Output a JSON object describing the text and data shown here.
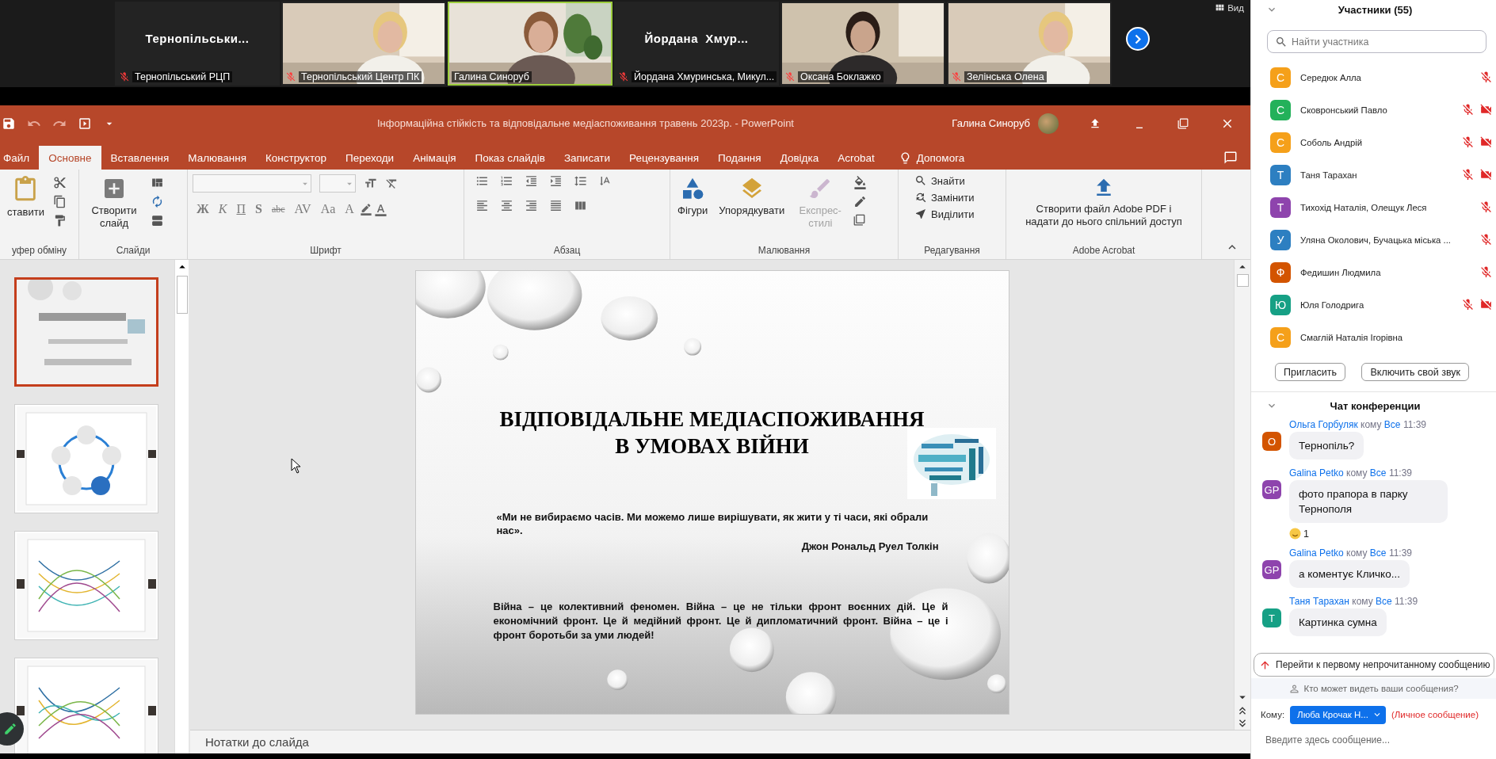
{
  "meeting_strip": {
    "tiles": [
      {
        "kind": "name",
        "display_name": "Тернопільськи...",
        "label": "Тернопільський РЦП",
        "muted": true,
        "speaking": false
      },
      {
        "kind": "video",
        "label": "Тернопільський Центр ПК",
        "muted": true,
        "speaking": false
      },
      {
        "kind": "video",
        "label": "Галина Синоруб",
        "muted": false,
        "speaking": true
      },
      {
        "kind": "name",
        "display_name": "Йордана  Хмур...",
        "label": "Йордана Хмуринська, Микул...",
        "muted": true,
        "speaking": false
      },
      {
        "kind": "video",
        "label": "Оксана Боклажко",
        "muted": true,
        "speaking": false
      },
      {
        "kind": "video",
        "label": "Зелінська Олена",
        "muted": true,
        "speaking": false
      }
    ],
    "view_button": "Вид"
  },
  "powerpoint": {
    "title": "Інформаційна стійкість та відповідальне медіаспоживання травень 2023р.  -  PowerPoint",
    "user": "Галина Синоруб",
    "tabs": [
      {
        "label": "Файл",
        "selected": false
      },
      {
        "label": "Основне",
        "selected": true
      },
      {
        "label": "Вставлення",
        "selected": false
      },
      {
        "label": "Малювання",
        "selected": false
      },
      {
        "label": "Конструктор",
        "selected": false
      },
      {
        "label": "Переходи",
        "selected": false
      },
      {
        "label": "Анімація",
        "selected": false
      },
      {
        "label": "Показ слайдів",
        "selected": false
      },
      {
        "label": "Записати",
        "selected": false
      },
      {
        "label": "Рецензування",
        "selected": false
      },
      {
        "label": "Подання",
        "selected": false
      },
      {
        "label": "Довідка",
        "selected": false
      },
      {
        "label": "Acrobat",
        "selected": false
      }
    ],
    "help": "Допомога",
    "ribbon": {
      "clipboard": {
        "paste": "ставити",
        "label": "уфер обміну"
      },
      "slides": {
        "new_slide": "Створити слайд",
        "label": "Слайди"
      },
      "font": {
        "format_buttons": [
          "Ж",
          "К",
          "П",
          "S",
          "abc",
          "AV",
          "Aa",
          "A"
        ],
        "label": "Шрифт"
      },
      "paragraph": {
        "label": "Абзац"
      },
      "drawing": {
        "buttons": [
          {
            "label": "Фігури",
            "disabled": false
          },
          {
            "label": "Упорядкувати",
            "disabled": false
          },
          {
            "label": "Експрес-стилі",
            "disabled": true
          }
        ],
        "label": "Малювання"
      },
      "editing": {
        "buttons": [
          "Знайти",
          "Замінити",
          "Виділити"
        ],
        "label": "Редагування"
      },
      "acrobat": {
        "button": [
          "Створити файл Adobe PDF і",
          "надати до нього спільний доступ"
        ],
        "label": "Adobe Acrobat"
      }
    },
    "thumbnails": [
      {
        "selected": true
      },
      {
        "selected": false
      },
      {
        "selected": false
      },
      {
        "selected": false
      }
    ],
    "slide": {
      "title_lines": [
        "ВІДПОВІДАЛЬНЕ МЕДІАСПОЖИВАННЯ",
        "В УМОВАХ ВІЙНИ"
      ],
      "quote": "«Ми не вибираємо часів. Ми можемо лише вирішувати, як жити у ті часи, які обрали нас».",
      "author": "Джон Рональд Руел Толкін",
      "paragraph": "Війна – це колективний феномен. Війна – це не тільки фронт воєнних дій. Це й економічний фронт. Це й медійний фронт. Це й дипломатичний фронт. Війна – це і фронт боротьби за уми людей!"
    },
    "notes": "Нотатки до слайда"
  },
  "participants": {
    "title": "Участники (55)",
    "search_placeholder": "Найти участника",
    "list": [
      {
        "initial": "С",
        "name": "Середюк Алла",
        "color": "#f5a01a",
        "mic_muted": true,
        "video_off": false
      },
      {
        "initial": "С",
        "name": "Сковронський Павло",
        "color": "#23b15a",
        "mic_muted": true,
        "video_off": true
      },
      {
        "initial": "С",
        "name": "Соболь Андрій",
        "color": "#f5a01a",
        "mic_muted": true,
        "video_off": true
      },
      {
        "initial": "Т",
        "name": "Таня Тарахан",
        "color": "#2d7fc1",
        "mic_muted": true,
        "video_off": true
      },
      {
        "initial": "Т",
        "name": "Тихохід Наталія, Олещук Леся",
        "color": "#8e44ad",
        "mic_muted": true,
        "video_off": false
      },
      {
        "initial": "У",
        "name": "Уляна Околович, Бучацька міська ...",
        "color": "#2d7fc1",
        "mic_muted": true,
        "video_off": false
      },
      {
        "initial": "Ф",
        "name": "Федишин Людмила",
        "color": "#d35400",
        "mic_muted": true,
        "video_off": false
      },
      {
        "initial": "Ю",
        "name": "Юля Голодрига",
        "color": "#16a085",
        "mic_muted": true,
        "video_off": true
      },
      {
        "initial": "С",
        "name": "Смаглій Наталія Ігорівна",
        "color": "#f5a01a",
        "mic_muted": false,
        "video_off": false
      }
    ],
    "buttons": [
      "Пригласить",
      "Включить свой звук"
    ]
  },
  "chat": {
    "title": "Чат конференции",
    "messages": [
      {
        "sender": "Ольга Горбуляк",
        "to_word": "кому",
        "to": "Все",
        "time": "11:39",
        "initials": "О",
        "color": "#d35400",
        "text": "Тернопіль?"
      },
      {
        "sender": "Galina Petko",
        "to_word": "кому",
        "to": "Все",
        "time": "11:39",
        "initials": "GP",
        "color": "#8e44ad",
        "text": "фото прапора в парку Тернополя",
        "reaction_count": "1"
      },
      {
        "sender": "Galina Petko",
        "to_word": "кому",
        "to": "Все",
        "time": "11:39",
        "initials": "GP",
        "color": "#8e44ad",
        "text": "а коментує Кличко..."
      },
      {
        "sender": "Таня Тарахан",
        "to_word": "кому",
        "to": "Все",
        "time": "11:39",
        "initials": "Т",
        "color": "#16a085",
        "text": "Картинка сумна"
      }
    ],
    "jump_button": "Перейти к первому непрочитанному сообщению",
    "visibility": "Кто может видеть ваши сообщения?",
    "to_label": "Кому:",
    "recipient": "Люба Крочак Н...",
    "private_note": "(Личное сообщение)",
    "placeholder": "Введите здесь сообщение..."
  }
}
